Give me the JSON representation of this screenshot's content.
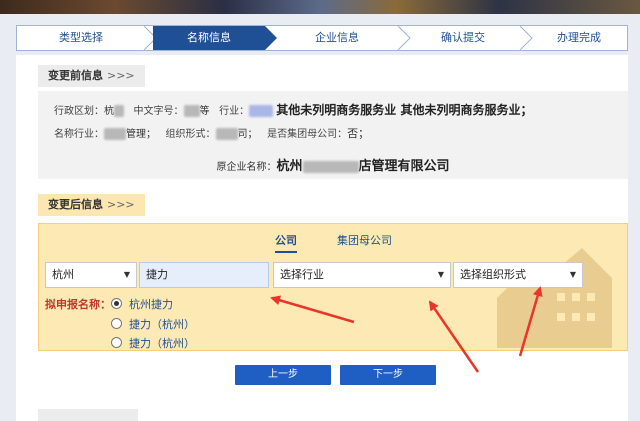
{
  "steps": [
    {
      "label": "类型选择",
      "active": false
    },
    {
      "label": "名称信息",
      "active": true
    },
    {
      "label": "企业信息",
      "active": false
    },
    {
      "label": "确认提交",
      "active": false
    },
    {
      "label": "办理完成",
      "active": false
    }
  ],
  "before": {
    "title": "变更前信息",
    "arrows": ">>>",
    "row1": {
      "region_label": "行政区划：",
      "region_value": "杭",
      "word_label": "中文字号：",
      "word_value": "等",
      "industry_label": "行业：",
      "industry_value": "其他未列明商务服务业 其他未列明商务服务业；"
    },
    "row2": {
      "name_industry_label": "名称行业：",
      "name_industry_value": "管理",
      "org_form_label": "组织形式：",
      "org_form_value": "司",
      "group_label": "是否集团母公司：",
      "group_value": "否；"
    },
    "orig_name_label": "原企业名称：",
    "orig_name_prefix": "杭州",
    "orig_name_suffix": "店管理有限公司"
  },
  "after": {
    "title": "变更后信息",
    "arrows": ">>>",
    "tabs": [
      "公司",
      "集团母公司"
    ],
    "region_select": "杭州",
    "word_input": "捷力",
    "industry_select": "选择行业",
    "org_form_select": "选择组织形式",
    "name_label": "拟申报名称：",
    "options": [
      {
        "label": "杭州捷力",
        "selected": true
      },
      {
        "label": "捷力（杭州）",
        "selected": false
      },
      {
        "label": "捷力（杭州）",
        "selected": false
      }
    ]
  },
  "buttons": {
    "prev": "上一步",
    "next": "下一步"
  },
  "colors": {
    "primary": "#1f4f94",
    "button": "#1f5fc4",
    "after_bg": "#fde9b4",
    "annotation_red": "#e8362a"
  }
}
